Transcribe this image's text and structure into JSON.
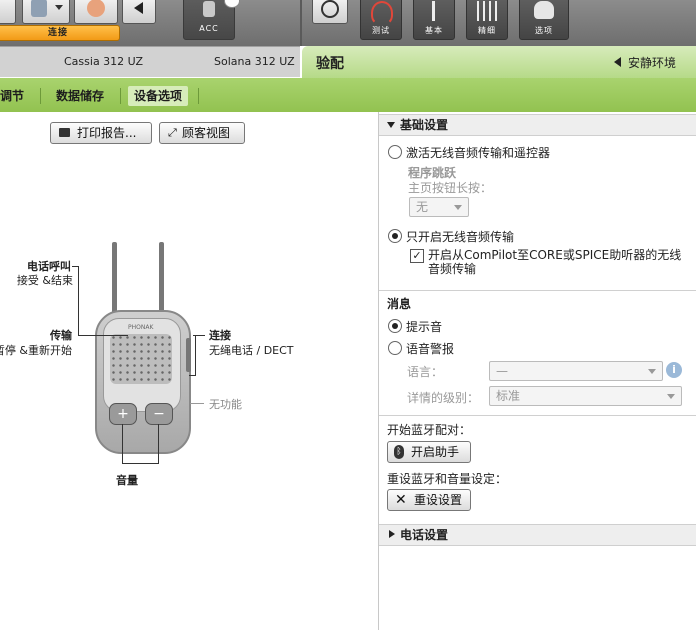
{
  "toolbar": {
    "connect_label": "连接",
    "acc_label": "ACC",
    "tabs": [
      {
        "label": "测试",
        "icon": "ear-sound-icon"
      },
      {
        "label": "基本",
        "icon": "single-slider-icon"
      },
      {
        "label": "精细",
        "icon": "multi-slider-icon"
      },
      {
        "label": "选项",
        "icon": "hand-options-icon"
      }
    ]
  },
  "devices": {
    "left": "Cassia 312 UZ",
    "right": "Solana 312 UZ"
  },
  "fitting": {
    "title": "验配",
    "environment": "安静环境"
  },
  "subtabs": {
    "adjust": "调节",
    "data_storage": "数据储存",
    "device_options": "设备选项"
  },
  "actions": {
    "print_report": "打印报告...",
    "customer_view": "顾客视图"
  },
  "diagram": {
    "phone_call_title": "电话呼叫",
    "phone_call_desc": "接受 &结束",
    "transfer_title": "传输",
    "transfer_desc": "暂停 &重新开始",
    "connect_title": "连接",
    "connect_desc": "无绳电话 / DECT",
    "no_function": "无功能",
    "volume": "音量",
    "brand": "PHONAK"
  },
  "basic_settings": {
    "header": "基础设置",
    "option_activate": "激活无线音频传输和遥控器",
    "program_jump": "程序跳跃",
    "home_button_long_press": "主页按钮长按：",
    "home_button_value": "无",
    "option_only_audio": "只开启无线音频传输",
    "checkbox_label": "开启从ComPilot至CORE或SPICE助听器的无线音频传输"
  },
  "messages": {
    "header": "消息",
    "beep": "提示音",
    "voice_alert": "语音警报",
    "language_label": "语言：",
    "language_value": "—",
    "detail_label": "详情的级别：",
    "detail_value": "标准"
  },
  "bluetooth": {
    "pairing_label": "开始蓝牙配对：",
    "pairing_button": "开启助手",
    "reset_label": "重设蓝牙和音量设定：",
    "reset_button": "重设设置"
  },
  "phone_settings": {
    "header": "电话设置"
  }
}
